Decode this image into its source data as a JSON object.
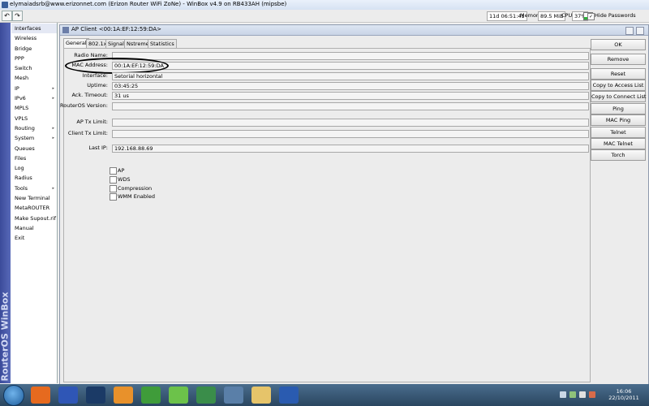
{
  "window": {
    "title": "elymaiadsrb@www.erizonnet.com (Erizon Router WiFi ZoNe) - WinBox v4.9 on RB433AH (mipsbe)"
  },
  "toolbar": {
    "undo_symbol": "↶",
    "redo_symbol": "↷",
    "uptime": "11d 06:51:41",
    "memory_label": "Memory:",
    "memory_value": "89.5 MiB",
    "cpu_label": "CPU:",
    "cpu_value": "37%",
    "hide_passwords_label": "Hide Passwords",
    "hide_passwords_checked": true
  },
  "sidebar": {
    "brand": "RouterOS WinBox",
    "items": [
      {
        "label": "Interfaces",
        "submenu": false
      },
      {
        "label": "Wireless",
        "submenu": false
      },
      {
        "label": "Bridge",
        "submenu": false
      },
      {
        "label": "PPP",
        "submenu": false
      },
      {
        "label": "Switch",
        "submenu": false
      },
      {
        "label": "Mesh",
        "submenu": false
      },
      {
        "label": "IP",
        "submenu": true
      },
      {
        "label": "IPv6",
        "submenu": true
      },
      {
        "label": "MPLS",
        "submenu": false
      },
      {
        "label": "VPLS",
        "submenu": false
      },
      {
        "label": "Routing",
        "submenu": true
      },
      {
        "label": "System",
        "submenu": true
      },
      {
        "label": "Queues",
        "submenu": false
      },
      {
        "label": "Files",
        "submenu": false
      },
      {
        "label": "Log",
        "submenu": false
      },
      {
        "label": "Radius",
        "submenu": false
      },
      {
        "label": "Tools",
        "submenu": true
      },
      {
        "label": "New Terminal",
        "submenu": false
      },
      {
        "label": "MetaROUTER",
        "submenu": false
      },
      {
        "label": "Make Supout.rif",
        "submenu": false
      },
      {
        "label": "Manual",
        "submenu": false
      },
      {
        "label": "Exit",
        "submenu": false
      }
    ],
    "submenu_arrow": "▸"
  },
  "dialog": {
    "title": "AP Client <00:1A:EF:12:59:DA>",
    "tabs": [
      "General",
      "802.1x",
      "Signal",
      "Nstreme",
      "Statistics"
    ],
    "active_tab": "General",
    "fields": {
      "radio_name": {
        "label": "Radio Name:",
        "value": ""
      },
      "mac_address": {
        "label": "MAC Address:",
        "value": "00:1A:EF:12:59:DA"
      },
      "interface": {
        "label": "Interface:",
        "value": "Setorial horizontal"
      },
      "uptime": {
        "label": "Uptime:",
        "value": "03:45:25"
      },
      "ack_timeout": {
        "label": "Ack. Timeout:",
        "value": "31 us"
      },
      "routeros_version": {
        "label": "RouterOS Version:",
        "value": ""
      },
      "ap_tx_limit": {
        "label": "AP Tx Limit:",
        "value": ""
      },
      "client_tx_limit": {
        "label": "Client Tx Limit:",
        "value": ""
      },
      "last_ip": {
        "label": "Last IP:",
        "value": "192.168.88.69"
      }
    },
    "checkboxes": [
      {
        "label": "AP",
        "checked": false
      },
      {
        "label": "WDS",
        "checked": false
      },
      {
        "label": "Compression",
        "checked": false
      },
      {
        "label": "WMM Enabled",
        "checked": false
      }
    ],
    "buttons": {
      "ok": "OK",
      "remove": "Remove",
      "reset": "Reset",
      "copy_access": "Copy to Access List",
      "copy_connect": "Copy to Connect List",
      "ping": "Ping",
      "mac_ping": "MAC Ping",
      "telnet": "Telnet",
      "mac_telnet": "MAC Telnet",
      "torch": "Torch"
    }
  },
  "taskbar": {
    "time": "16:06",
    "date": "22/10/2011",
    "apps": [
      {
        "name": "firefox-icon",
        "color": "#e66a1f"
      },
      {
        "name": "winbox-icon",
        "color": "#2f56b6"
      },
      {
        "name": "photoshop-icon",
        "color": "#1b3a66"
      },
      {
        "name": "media-player-icon",
        "color": "#e8912b"
      },
      {
        "name": "chrome-icon",
        "color": "#3f9c3a"
      },
      {
        "name": "utorrent-icon",
        "color": "#6cc24a"
      },
      {
        "name": "network-app-icon",
        "color": "#3a8d4a"
      },
      {
        "name": "app-icon",
        "color": "#5a7fa8"
      },
      {
        "name": "folder-icon",
        "color": "#e6c46a"
      },
      {
        "name": "word-icon",
        "color": "#2a5bb0"
      }
    ]
  },
  "colors": {
    "sidebar_brand": "#3b4b9a",
    "taskbar": "#2a4660"
  }
}
